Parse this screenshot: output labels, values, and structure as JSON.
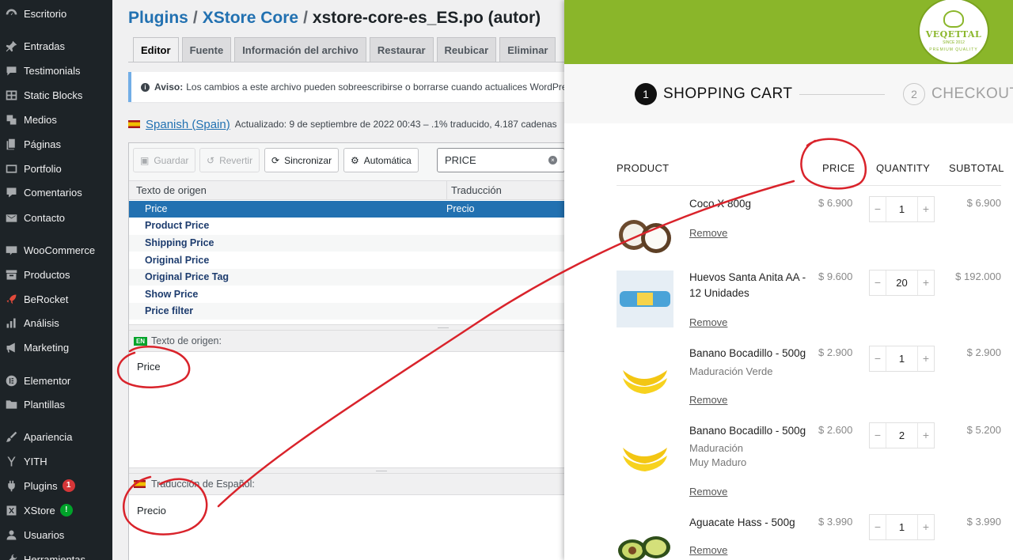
{
  "sidebar": {
    "items": [
      {
        "label": "Escritorio",
        "icon": "dashboard-icon",
        "badge": ""
      },
      {
        "label": "Entradas",
        "icon": "pin-icon",
        "badge": ""
      },
      {
        "label": "Testimonials",
        "icon": "speech-bubble-icon",
        "badge": ""
      },
      {
        "label": "Static Blocks",
        "icon": "grid-icon",
        "badge": ""
      },
      {
        "label": "Medios",
        "icon": "media-icon",
        "badge": ""
      },
      {
        "label": "Páginas",
        "icon": "pages-icon",
        "badge": ""
      },
      {
        "label": "Portfolio",
        "icon": "portfolio-icon",
        "badge": ""
      },
      {
        "label": "Comentarios",
        "icon": "comment-icon",
        "badge": ""
      },
      {
        "label": "Contacto",
        "icon": "mail-icon",
        "badge": ""
      },
      {
        "label": "WooCommerce",
        "icon": "woocommerce-icon",
        "badge": ""
      },
      {
        "label": "Productos",
        "icon": "archive-icon",
        "badge": ""
      },
      {
        "label": "BeRocket",
        "icon": "rocket-icon",
        "badge": ""
      },
      {
        "label": "Análisis",
        "icon": "bar-chart-icon",
        "badge": ""
      },
      {
        "label": "Marketing",
        "icon": "megaphone-icon",
        "badge": ""
      },
      {
        "label": "Elementor",
        "icon": "elementor-icon",
        "badge": ""
      },
      {
        "label": "Plantillas",
        "icon": "folder-icon",
        "badge": ""
      },
      {
        "label": "Apariencia",
        "icon": "paintbrush-icon",
        "badge": ""
      },
      {
        "label": "YITH",
        "icon": "yith-icon",
        "badge": ""
      },
      {
        "label": "Plugins",
        "icon": "plugin-icon",
        "badge": "1"
      },
      {
        "label": "XStore",
        "icon": "xstore-icon",
        "badge": "!"
      },
      {
        "label": "Usuarios",
        "icon": "users-icon",
        "badge": ""
      },
      {
        "label": "Herramientas",
        "icon": "tools-icon",
        "badge": ""
      }
    ]
  },
  "editor": {
    "breadcrumb": {
      "plugins": "Plugins",
      "core": "XStore Core",
      "file": "xstore-core-es_ES.po (autor)",
      "separator": "/"
    },
    "tabs": [
      "Editor",
      "Fuente",
      "Información del archivo",
      "Restaurar",
      "Reubicar",
      "Eliminar"
    ],
    "notice": {
      "title": "Aviso:",
      "text": "Los cambios a este archivo pueden sobreescribirse o borrarse cuando actualices WordPress"
    },
    "language": {
      "name": "Spanish (Spain)",
      "status": "Actualizado: 9 de septiembre de 2022 00:43 – .1% traducido, 4.187 cadenas"
    },
    "toolbar": {
      "save": "Guardar",
      "revert": "Revertir",
      "sync": "Sincronizar",
      "auto": "Automática",
      "search_value": "PRICE"
    },
    "grid": {
      "col_source": "Texto de origen",
      "col_translation": "Traducción",
      "rows": [
        {
          "source": "Price",
          "translation": "Precio"
        },
        {
          "source": "Product Price",
          "translation": ""
        },
        {
          "source": "Shipping Price",
          "translation": ""
        },
        {
          "source": "Original Price",
          "translation": ""
        },
        {
          "source": "Original Price Tag",
          "translation": ""
        },
        {
          "source": "Show Price",
          "translation": ""
        },
        {
          "source": "Price filter",
          "translation": ""
        }
      ]
    },
    "source_panel": {
      "tag": "EN",
      "label": "Texto de origen:",
      "text": "Price"
    },
    "translation_panel": {
      "label": "Traducción de Español:",
      "text": "Precio"
    }
  },
  "store": {
    "logo": {
      "name": "VEQETTAL",
      "since": "SINCE 2012",
      "tagline": "PREMIUM QUALITY"
    },
    "steps": [
      {
        "num": "1",
        "label": "SHOPPING CART"
      },
      {
        "num": "2",
        "label": "CHECKOUT"
      }
    ],
    "columns": {
      "product": "PRODUCT",
      "price": "PRICE",
      "quantity": "QUANTITY",
      "subtotal": "SUBTOTAL"
    },
    "items": [
      {
        "name": "Coco X 800g",
        "meta": [],
        "price": "$ 6.900",
        "qty": "1",
        "subtotal": "$ 6.900",
        "remove": "Remove",
        "image": "coconut-image"
      },
      {
        "name": "Huevos Santa Anita AA - 12 Unidades",
        "meta": [],
        "price": "$ 9.600",
        "qty": "20",
        "subtotal": "$ 192.000",
        "remove": "Remove",
        "image": "eggs-image"
      },
      {
        "name": "Banano Bocadillo - 500g",
        "meta": [
          "Maduración  Verde"
        ],
        "price": "$ 2.900",
        "qty": "1",
        "subtotal": "$ 2.900",
        "remove": "Remove",
        "image": "banana-image"
      },
      {
        "name": "Banano Bocadillo - 500g",
        "meta": [
          "Maduración",
          "Muy Maduro"
        ],
        "price": "$ 2.600",
        "qty": "2",
        "subtotal": "$ 5.200",
        "remove": "Remove",
        "image": "banana-image"
      },
      {
        "name": "Aguacate Hass - 500g",
        "meta": [],
        "price": "$ 3.990",
        "qty": "1",
        "subtotal": "$ 3.990",
        "remove": "Remove",
        "image": "avocado-image"
      }
    ],
    "qty_minus": "−",
    "qty_plus": "+"
  },
  "colors": {
    "wp_sidebar": "#1d2327",
    "wp_blue": "#2271b1",
    "store_green": "#8ab62a",
    "annotation_red": "#d9232b"
  }
}
